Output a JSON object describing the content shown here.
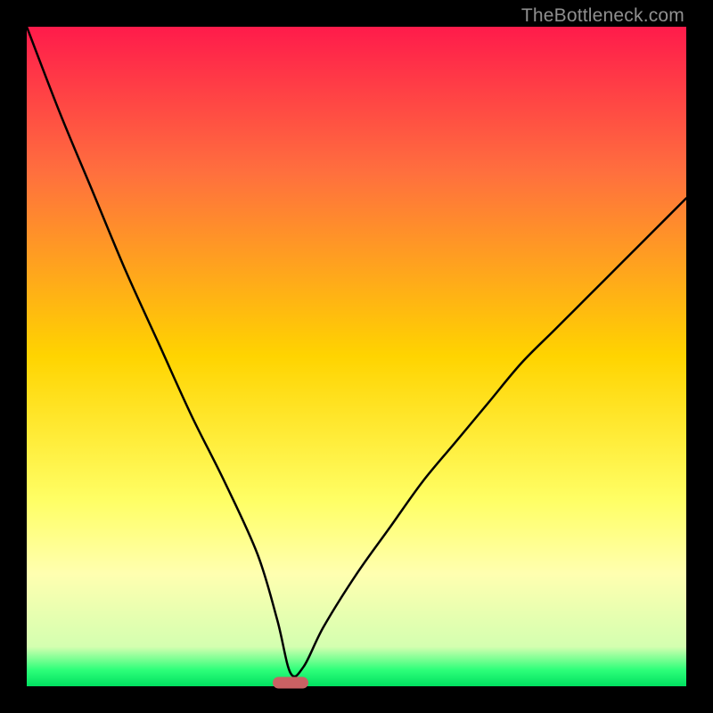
{
  "watermark": "TheBottleneck.com",
  "chart_data": {
    "type": "line",
    "title": "",
    "xlabel": "",
    "ylabel": "",
    "xlim": [
      0,
      100
    ],
    "ylim": [
      0,
      100
    ],
    "grid": false,
    "legend": false,
    "series": [
      {
        "name": "curve",
        "x": [
          0,
          5,
          10,
          15,
          20,
          25,
          30,
          35,
          38,
          40,
          42,
          45,
          50,
          55,
          60,
          65,
          70,
          75,
          80,
          85,
          90,
          95,
          100
        ],
        "values": [
          100,
          87,
          75,
          63,
          52,
          41,
          31,
          20,
          10,
          2,
          3,
          9,
          17,
          24,
          31,
          37,
          43,
          49,
          54,
          59,
          64,
          69,
          74
        ]
      }
    ],
    "marker": {
      "x": 40,
      "y": 0,
      "color": "#c96163"
    },
    "gradient_stops": [
      {
        "offset": 0.0,
        "color": "#ff1b4b"
      },
      {
        "offset": 0.22,
        "color": "#ff6f3e"
      },
      {
        "offset": 0.5,
        "color": "#ffd400"
      },
      {
        "offset": 0.72,
        "color": "#ffff66"
      },
      {
        "offset": 0.83,
        "color": "#ffffb0"
      },
      {
        "offset": 0.94,
        "color": "#d4ffb0"
      },
      {
        "offset": 0.975,
        "color": "#2eff7a"
      },
      {
        "offset": 1.0,
        "color": "#00e060"
      }
    ]
  }
}
